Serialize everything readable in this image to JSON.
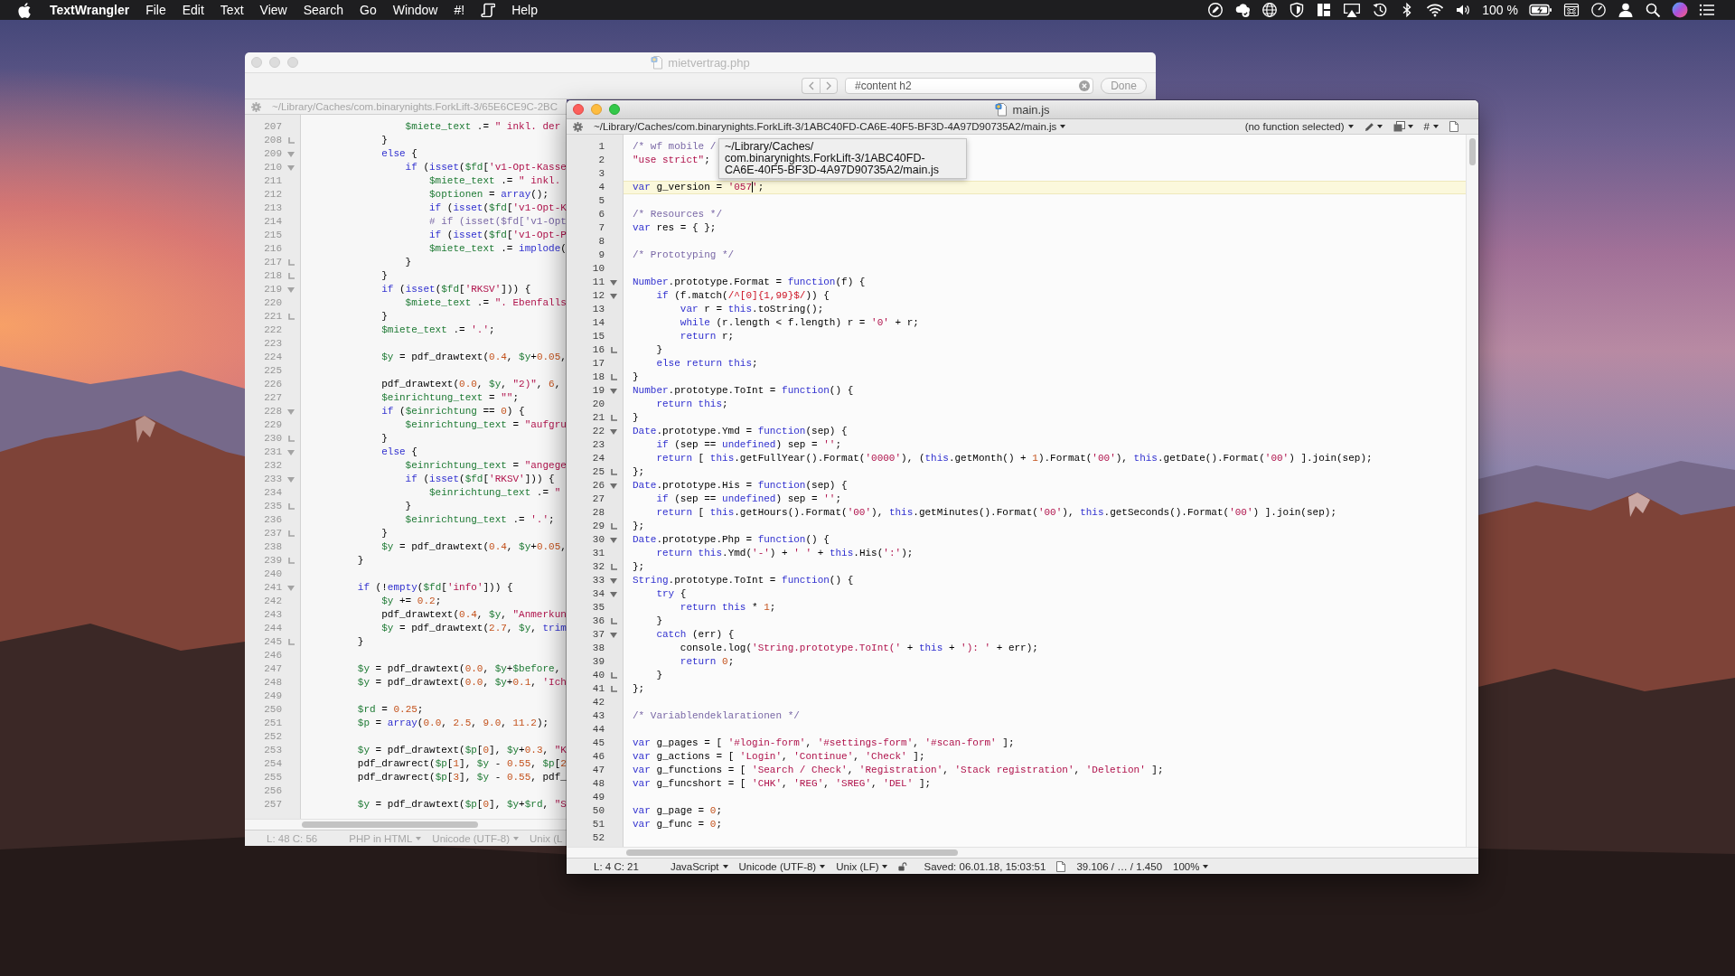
{
  "menu_bar": {
    "app_name": "TextWrangler",
    "menus": [
      {
        "kind": "label",
        "text": "File"
      },
      {
        "kind": "label",
        "text": "Edit"
      },
      {
        "kind": "label",
        "text": "Text"
      },
      {
        "kind": "label",
        "text": "View"
      },
      {
        "kind": "label",
        "text": "Search"
      },
      {
        "kind": "label",
        "text": "Go"
      },
      {
        "kind": "label",
        "text": "Window"
      },
      {
        "kind": "label",
        "text": "#!"
      },
      {
        "kind": "icon"
      },
      {
        "kind": "label",
        "text": "Help"
      }
    ],
    "battery_percent": "100 %"
  },
  "back_window": {
    "active": false,
    "title": "mietvertrag.php",
    "find_bar": {
      "query": "#content h2",
      "button": "Done"
    },
    "path_bar": {
      "path": {
        "kind": "label",
        "text": "~/Library/Caches/com.binarynights.ForkLift-3/65E6CE9C-2BC"
      }
    },
    "lines": [
      {
        "number": "207",
        "kind": "plain",
        "code": [
          {
            "variable": "                $miete_text"
          },
          {
            "plain": " .= "
          },
          {
            "string": "\" inkl. der"
          }
        ]
      },
      {
        "number": "208",
        "kind": "fold-end",
        "code": [
          {
            "plain": "            }"
          }
        ]
      },
      {
        "number": "209",
        "kind": "fold-start",
        "code": [
          {
            "keyword": "            else"
          },
          {
            "plain": " {"
          }
        ]
      },
      {
        "number": "210",
        "kind": "fold-start",
        "code": [
          {
            "keyword": "                if"
          },
          {
            "plain": " ("
          },
          {
            "keyword": "isset"
          },
          {
            "plain": "("
          },
          {
            "variable": "$fd"
          },
          {
            "plain": "["
          },
          {
            "string": "'v1-Opt-Kasse"
          }
        ]
      },
      {
        "number": "211",
        "kind": "plain",
        "code": [
          {
            "variable": "                    $miete_text"
          },
          {
            "plain": " .= "
          },
          {
            "string": "\" inkl."
          }
        ]
      },
      {
        "number": "212",
        "kind": "plain",
        "code": [
          {
            "variable": "                    $optionen"
          },
          {
            "plain": " = "
          },
          {
            "keyword": "array"
          },
          {
            "plain": "();"
          }
        ]
      },
      {
        "number": "213",
        "kind": "plain",
        "code": [
          {
            "keyword": "                    if"
          },
          {
            "plain": " ("
          },
          {
            "keyword": "isset"
          },
          {
            "plain": "("
          },
          {
            "variable": "$fd"
          },
          {
            "plain": "["
          },
          {
            "string": "'v1-Opt-K"
          }
        ]
      },
      {
        "number": "214",
        "kind": "plain",
        "code": [
          {
            "comment": "                    # if (isset($fd['v1-Opt"
          }
        ]
      },
      {
        "number": "215",
        "kind": "plain",
        "code": [
          {
            "keyword": "                    if"
          },
          {
            "plain": " ("
          },
          {
            "keyword": "isset"
          },
          {
            "plain": "("
          },
          {
            "variable": "$fd"
          },
          {
            "plain": "["
          },
          {
            "string": "'v1-Opt-P"
          }
        ]
      },
      {
        "number": "216",
        "kind": "plain",
        "code": [
          {
            "variable": "                    $miete_text"
          },
          {
            "plain": " .= "
          },
          {
            "keyword": "implode"
          },
          {
            "plain": "("
          }
        ]
      },
      {
        "number": "217",
        "kind": "fold-end",
        "code": [
          {
            "plain": "                }"
          }
        ]
      },
      {
        "number": "218",
        "kind": "fold-end",
        "code": [
          {
            "plain": "            }"
          }
        ]
      },
      {
        "number": "219",
        "kind": "fold-start",
        "code": [
          {
            "keyword": "            if"
          },
          {
            "plain": " ("
          },
          {
            "keyword": "isset"
          },
          {
            "plain": "("
          },
          {
            "variable": "$fd"
          },
          {
            "plain": "["
          },
          {
            "string": "'RKSV'"
          },
          {
            "plain": "])) {"
          }
        ]
      },
      {
        "number": "220",
        "kind": "plain",
        "code": [
          {
            "variable": "                $miete_text"
          },
          {
            "plain": " .= "
          },
          {
            "string": "\". Ebenfalls"
          }
        ]
      },
      {
        "number": "221",
        "kind": "fold-end",
        "code": [
          {
            "plain": "            }"
          }
        ]
      },
      {
        "number": "222",
        "kind": "plain",
        "code": [
          {
            "variable": "            $miete_text"
          },
          {
            "plain": " .= "
          },
          {
            "string": "'.'"
          },
          {
            "plain": ";"
          }
        ]
      },
      {
        "number": "223",
        "kind": "plain"
      },
      {
        "number": "224",
        "kind": "plain",
        "code": [
          {
            "variable": "            $y"
          },
          {
            "plain": " = pdf_drawtext("
          },
          {
            "number": "0.4"
          },
          {
            "plain": ", "
          },
          {
            "variable": "$y"
          },
          {
            "plain": "+"
          },
          {
            "number": "0.05"
          },
          {
            "plain": ","
          }
        ]
      },
      {
        "number": "225",
        "kind": "plain"
      },
      {
        "number": "226",
        "kind": "plain",
        "code": [
          {
            "plain": "            pdf_drawtext("
          },
          {
            "number": "0.0"
          },
          {
            "plain": ", "
          },
          {
            "variable": "$y"
          },
          {
            "plain": ", "
          },
          {
            "string": "\"2)\""
          },
          {
            "plain": ", "
          },
          {
            "number": "6"
          },
          {
            "plain": ","
          }
        ]
      },
      {
        "number": "227",
        "kind": "plain",
        "code": [
          {
            "variable": "            $einrichtung_text"
          },
          {
            "plain": " = "
          },
          {
            "string": "\"\""
          },
          {
            "plain": ";"
          }
        ]
      },
      {
        "number": "228",
        "kind": "fold-start",
        "code": [
          {
            "keyword": "            if"
          },
          {
            "plain": " ("
          },
          {
            "variable": "$einrichtung"
          },
          {
            "plain": " == "
          },
          {
            "number": "0"
          },
          {
            "plain": ") {"
          }
        ]
      },
      {
        "number": "229",
        "kind": "plain",
        "code": [
          {
            "variable": "                $einrichtung_text"
          },
          {
            "plain": " = "
          },
          {
            "string": "\"aufgru"
          }
        ]
      },
      {
        "number": "230",
        "kind": "fold-end",
        "code": [
          {
            "plain": "            }"
          }
        ]
      },
      {
        "number": "231",
        "kind": "fold-start",
        "code": [
          {
            "keyword": "            else"
          },
          {
            "plain": " {"
          }
        ]
      },
      {
        "number": "232",
        "kind": "plain",
        "code": [
          {
            "variable": "                $einrichtung_text"
          },
          {
            "plain": " = "
          },
          {
            "string": "\"angege"
          }
        ]
      },
      {
        "number": "233",
        "kind": "fold-start",
        "code": [
          {
            "keyword": "                if"
          },
          {
            "plain": " ("
          },
          {
            "keyword": "isset"
          },
          {
            "plain": "("
          },
          {
            "variable": "$fd"
          },
          {
            "plain": "["
          },
          {
            "string": "'RKSV'"
          },
          {
            "plain": "])) {"
          }
        ]
      },
      {
        "number": "234",
        "kind": "plain",
        "code": [
          {
            "variable": "                    $einrichtung_text"
          },
          {
            "plain": " .= "
          },
          {
            "string": "\""
          }
        ]
      },
      {
        "number": "235",
        "kind": "fold-end",
        "code": [
          {
            "plain": "                }"
          }
        ]
      },
      {
        "number": "236",
        "kind": "plain",
        "code": [
          {
            "variable": "                $einrichtung_text"
          },
          {
            "plain": " .= "
          },
          {
            "string": "'.'"
          },
          {
            "plain": ";"
          }
        ]
      },
      {
        "number": "237",
        "kind": "fold-end",
        "code": [
          {
            "plain": "            }"
          }
        ]
      },
      {
        "number": "238",
        "kind": "plain",
        "code": [
          {
            "variable": "            $y"
          },
          {
            "plain": " = pdf_drawtext("
          },
          {
            "number": "0.4"
          },
          {
            "plain": ", "
          },
          {
            "variable": "$y"
          },
          {
            "plain": "+"
          },
          {
            "number": "0.05"
          },
          {
            "plain": ","
          }
        ]
      },
      {
        "number": "239",
        "kind": "fold-end",
        "code": [
          {
            "plain": "        }"
          }
        ]
      },
      {
        "number": "240",
        "kind": "plain"
      },
      {
        "number": "241",
        "kind": "fold-start",
        "code": [
          {
            "keyword": "        if"
          },
          {
            "plain": " (!"
          },
          {
            "keyword": "empty"
          },
          {
            "plain": "("
          },
          {
            "variable": "$fd"
          },
          {
            "plain": "["
          },
          {
            "string": "'info'"
          },
          {
            "plain": "])) {"
          }
        ]
      },
      {
        "number": "242",
        "kind": "plain",
        "code": [
          {
            "variable": "            $y"
          },
          {
            "plain": " += "
          },
          {
            "number": "0.2"
          },
          {
            "plain": ";"
          }
        ]
      },
      {
        "number": "243",
        "kind": "plain",
        "code": [
          {
            "plain": "            pdf_drawtext("
          },
          {
            "number": "0.4"
          },
          {
            "plain": ", "
          },
          {
            "variable": "$y"
          },
          {
            "plain": ", "
          },
          {
            "string": "\"Anmerkun"
          }
        ]
      },
      {
        "number": "244",
        "kind": "plain",
        "code": [
          {
            "variable": "            $y"
          },
          {
            "plain": " = pdf_drawtext("
          },
          {
            "number": "2.7"
          },
          {
            "plain": ", "
          },
          {
            "variable": "$y"
          },
          {
            "plain": ", "
          },
          {
            "keyword": "trim"
          }
        ]
      },
      {
        "number": "245",
        "kind": "fold-end",
        "code": [
          {
            "plain": "        }"
          }
        ]
      },
      {
        "number": "246",
        "kind": "plain"
      },
      {
        "number": "247",
        "kind": "plain",
        "code": [
          {
            "variable": "        $y"
          },
          {
            "plain": " = pdf_drawtext("
          },
          {
            "number": "0.0"
          },
          {
            "plain": ", "
          },
          {
            "variable": "$y"
          },
          {
            "plain": "+"
          },
          {
            "variable": "$before"
          },
          {
            "plain": ","
          }
        ]
      },
      {
        "number": "248",
        "kind": "plain",
        "code": [
          {
            "variable": "        $y"
          },
          {
            "plain": " = pdf_drawtext("
          },
          {
            "number": "0.0"
          },
          {
            "plain": ", "
          },
          {
            "variable": "$y"
          },
          {
            "plain": "+"
          },
          {
            "number": "0.1"
          },
          {
            "plain": ", "
          },
          {
            "string": "'Ich"
          }
        ]
      },
      {
        "number": "249",
        "kind": "plain"
      },
      {
        "number": "250",
        "kind": "plain",
        "code": [
          {
            "variable": "        $rd"
          },
          {
            "plain": " = "
          },
          {
            "number": "0.25"
          },
          {
            "plain": ";"
          }
        ]
      },
      {
        "number": "251",
        "kind": "plain",
        "code": [
          {
            "variable": "        $p"
          },
          {
            "plain": " = "
          },
          {
            "keyword": "array"
          },
          {
            "plain": "("
          },
          {
            "number": "0.0"
          },
          {
            "plain": ", "
          },
          {
            "number": "2.5"
          },
          {
            "plain": ", "
          },
          {
            "number": "9.0"
          },
          {
            "plain": ", "
          },
          {
            "number": "11.2"
          },
          {
            "plain": ");"
          }
        ]
      },
      {
        "number": "252",
        "kind": "plain"
      },
      {
        "number": "253",
        "kind": "plain",
        "code": [
          {
            "variable": "        $y"
          },
          {
            "plain": " = pdf_drawtext("
          },
          {
            "variable": "$p"
          },
          {
            "plain": "["
          },
          {
            "number": "0"
          },
          {
            "plain": "], "
          },
          {
            "variable": "$y"
          },
          {
            "plain": "+"
          },
          {
            "number": "0.3"
          },
          {
            "plain": ", "
          },
          {
            "string": "\"K"
          }
        ]
      },
      {
        "number": "254",
        "kind": "plain",
        "code": [
          {
            "plain": "        pdf_drawrect("
          },
          {
            "variable": "$p"
          },
          {
            "plain": "["
          },
          {
            "number": "1"
          },
          {
            "plain": "], "
          },
          {
            "variable": "$y"
          },
          {
            "plain": " - "
          },
          {
            "number": "0.55"
          },
          {
            "plain": ", "
          },
          {
            "variable": "$p"
          },
          {
            "plain": "["
          },
          {
            "number": "2"
          }
        ]
      },
      {
        "number": "255",
        "kind": "plain",
        "code": [
          {
            "plain": "        pdf_drawrect("
          },
          {
            "variable": "$p"
          },
          {
            "plain": "["
          },
          {
            "number": "3"
          },
          {
            "plain": "], "
          },
          {
            "variable": "$y"
          },
          {
            "plain": " - "
          },
          {
            "number": "0.55"
          },
          {
            "plain": ", pdf_"
          }
        ]
      },
      {
        "number": "256",
        "kind": "plain"
      },
      {
        "number": "257",
        "kind": "plain",
        "code": [
          {
            "variable": "        $y"
          },
          {
            "plain": " = pdf_drawtext("
          },
          {
            "variable": "$p"
          },
          {
            "plain": "["
          },
          {
            "number": "0"
          },
          {
            "plain": "], "
          },
          {
            "variable": "$y"
          },
          {
            "plain": "+"
          },
          {
            "variable": "$rd"
          },
          {
            "plain": ", "
          },
          {
            "string": "\"S"
          }
        ]
      }
    ],
    "status_bar": [
      {
        "kind": "label",
        "text": "L: 48 C: 56"
      },
      {
        "kind": "menu",
        "text": "PHP in HTML"
      },
      {
        "kind": "menu",
        "text": "Unicode (UTF-8)"
      },
      {
        "kind": "label",
        "text": "Unix (L"
      }
    ]
  },
  "front_window": {
    "active": true,
    "title": "main.js",
    "path_bar": {
      "path": {
        "kind": "menu",
        "text": "~/Library/Caches/com.binarynights.ForkLift-3/1ABC40FD-CA6E-40F5-BF3D-4A97D90735A2/main.js"
      },
      "tools": [
        {
          "kind": "menu",
          "text": "(no function selected)"
        },
        {
          "kind": "pen-menu"
        },
        {
          "kind": "pages-menu"
        },
        {
          "kind": "menu",
          "text": "#"
        },
        {
          "kind": "document"
        }
      ]
    },
    "tooltip": {
      "lines": [
        "~/Library/Caches/",
        "com.binarynights.ForkLift-3/1ABC40FD-",
        "CA6E-40F5-BF3D-4A97D90735A2/main.js"
      ]
    },
    "lines": [
      {
        "number": "1",
        "kind": "plain",
        "code": [
          {
            "comment": "/* wf mobile /"
          }
        ]
      },
      {
        "number": "2",
        "kind": "plain",
        "code": [
          {
            "string": "\"use strict\""
          },
          {
            "plain": ";"
          }
        ]
      },
      {
        "number": "3",
        "kind": "plain"
      },
      {
        "number": "4",
        "kind": "plain",
        "current": true,
        "code": [
          {
            "keyword": "var"
          },
          {
            "plain": " g_version = "
          },
          {
            "string": "'057"
          },
          {
            "caret": true
          },
          {
            "string": "'"
          },
          {
            "plain": ";"
          }
        ]
      },
      {
        "number": "5",
        "kind": "plain"
      },
      {
        "number": "6",
        "kind": "plain",
        "code": [
          {
            "comment": "/* Resources */"
          }
        ]
      },
      {
        "number": "7",
        "kind": "plain",
        "code": [
          {
            "keyword": "var"
          },
          {
            "plain": " res = { };"
          }
        ]
      },
      {
        "number": "8",
        "kind": "plain"
      },
      {
        "number": "9",
        "kind": "plain",
        "code": [
          {
            "comment": "/* Prototyping */"
          }
        ]
      },
      {
        "number": "10",
        "kind": "plain"
      },
      {
        "number": "11",
        "kind": "fold-start",
        "code": [
          {
            "keyword": "Number"
          },
          {
            "plain": ".prototype.Format = "
          },
          {
            "keyword": "function"
          },
          {
            "plain": "(f) {"
          }
        ]
      },
      {
        "number": "12",
        "kind": "fold-start",
        "code": [
          {
            "keyword": "    if"
          },
          {
            "plain": " (f.match("
          },
          {
            "regex": "/^[0]{1,99}$/"
          },
          {
            "plain": ")) {"
          }
        ]
      },
      {
        "number": "13",
        "kind": "plain",
        "code": [
          {
            "keyword": "        var"
          },
          {
            "plain": " r = "
          },
          {
            "keyword": "this"
          },
          {
            "plain": ".toString();"
          }
        ]
      },
      {
        "number": "14",
        "kind": "plain",
        "code": [
          {
            "keyword": "        while"
          },
          {
            "plain": " (r.length < f.length) r = "
          },
          {
            "string": "'0'"
          },
          {
            "plain": " + r;"
          }
        ]
      },
      {
        "number": "15",
        "kind": "plain",
        "code": [
          {
            "keyword": "        return"
          },
          {
            "plain": " r;"
          }
        ]
      },
      {
        "number": "16",
        "kind": "fold-end",
        "code": [
          {
            "plain": "    }"
          }
        ]
      },
      {
        "number": "17",
        "kind": "plain",
        "code": [
          {
            "keyword": "    else return this"
          },
          {
            "plain": ";"
          }
        ]
      },
      {
        "number": "18",
        "kind": "fold-end",
        "code": [
          {
            "plain": "}"
          }
        ]
      },
      {
        "number": "19",
        "kind": "fold-start",
        "code": [
          {
            "keyword": "Number"
          },
          {
            "plain": ".prototype.ToInt = "
          },
          {
            "keyword": "function"
          },
          {
            "plain": "() {"
          }
        ]
      },
      {
        "number": "20",
        "kind": "plain",
        "code": [
          {
            "keyword": "    return this"
          },
          {
            "plain": ";"
          }
        ]
      },
      {
        "number": "21",
        "kind": "fold-end",
        "code": [
          {
            "plain": "}"
          }
        ]
      },
      {
        "number": "22",
        "kind": "fold-start",
        "code": [
          {
            "keyword": "Date"
          },
          {
            "plain": ".prototype.Ymd = "
          },
          {
            "keyword": "function"
          },
          {
            "plain": "(sep) {"
          }
        ]
      },
      {
        "number": "23",
        "kind": "plain",
        "code": [
          {
            "keyword": "    if"
          },
          {
            "plain": " (sep == "
          },
          {
            "keyword": "undefined"
          },
          {
            "plain": ") sep = "
          },
          {
            "string": "''"
          },
          {
            "plain": ";"
          }
        ]
      },
      {
        "number": "24",
        "kind": "plain",
        "code": [
          {
            "keyword": "    return"
          },
          {
            "plain": " [ "
          },
          {
            "keyword": "this"
          },
          {
            "plain": ".getFullYear().Format("
          },
          {
            "string": "'0000'"
          },
          {
            "plain": "), ("
          },
          {
            "keyword": "this"
          },
          {
            "plain": ".getMonth() + "
          },
          {
            "number": "1"
          },
          {
            "plain": ").Format("
          },
          {
            "string": "'00'"
          },
          {
            "plain": "), "
          },
          {
            "keyword": "this"
          },
          {
            "plain": ".getDate().Format("
          },
          {
            "string": "'00'"
          },
          {
            "plain": ") ].join(sep);"
          }
        ]
      },
      {
        "number": "25",
        "kind": "fold-end",
        "code": [
          {
            "plain": "};"
          }
        ]
      },
      {
        "number": "26",
        "kind": "fold-start",
        "code": [
          {
            "keyword": "Date"
          },
          {
            "plain": ".prototype.His = "
          },
          {
            "keyword": "function"
          },
          {
            "plain": "(sep) {"
          }
        ]
      },
      {
        "number": "27",
        "kind": "plain",
        "code": [
          {
            "keyword": "    if"
          },
          {
            "plain": " (sep == "
          },
          {
            "keyword": "undefined"
          },
          {
            "plain": ") sep = "
          },
          {
            "string": "''"
          },
          {
            "plain": ";"
          }
        ]
      },
      {
        "number": "28",
        "kind": "plain",
        "code": [
          {
            "keyword": "    return"
          },
          {
            "plain": " [ "
          },
          {
            "keyword": "this"
          },
          {
            "plain": ".getHours().Format("
          },
          {
            "string": "'00'"
          },
          {
            "plain": "), "
          },
          {
            "keyword": "this"
          },
          {
            "plain": ".getMinutes().Format("
          },
          {
            "string": "'00'"
          },
          {
            "plain": "), "
          },
          {
            "keyword": "this"
          },
          {
            "plain": ".getSeconds().Format("
          },
          {
            "string": "'00'"
          },
          {
            "plain": ") ].join(sep);"
          }
        ]
      },
      {
        "number": "29",
        "kind": "fold-end",
        "code": [
          {
            "plain": "};"
          }
        ]
      },
      {
        "number": "30",
        "kind": "fold-start",
        "code": [
          {
            "keyword": "Date"
          },
          {
            "plain": ".prototype.Php = "
          },
          {
            "keyword": "function"
          },
          {
            "plain": "() {"
          }
        ]
      },
      {
        "number": "31",
        "kind": "plain",
        "code": [
          {
            "keyword": "    return this"
          },
          {
            "plain": ".Ymd("
          },
          {
            "string": "'-'"
          },
          {
            "plain": ") + "
          },
          {
            "string": "' '"
          },
          {
            "plain": " + "
          },
          {
            "keyword": "this"
          },
          {
            "plain": ".His("
          },
          {
            "string": "':'"
          },
          {
            "plain": ");"
          }
        ]
      },
      {
        "number": "32",
        "kind": "fold-end",
        "code": [
          {
            "plain": "};"
          }
        ]
      },
      {
        "number": "33",
        "kind": "fold-start",
        "code": [
          {
            "keyword": "String"
          },
          {
            "plain": ".prototype.ToInt = "
          },
          {
            "keyword": "function"
          },
          {
            "plain": "() {"
          }
        ]
      },
      {
        "number": "34",
        "kind": "fold-start",
        "code": [
          {
            "keyword": "    try"
          },
          {
            "plain": " {"
          }
        ]
      },
      {
        "number": "35",
        "kind": "plain",
        "code": [
          {
            "keyword": "        return this"
          },
          {
            "plain": " * "
          },
          {
            "number": "1"
          },
          {
            "plain": ";"
          }
        ]
      },
      {
        "number": "36",
        "kind": "fold-end",
        "code": [
          {
            "plain": "    }"
          }
        ]
      },
      {
        "number": "37",
        "kind": "fold-start",
        "code": [
          {
            "keyword": "    catch"
          },
          {
            "plain": " (err) {"
          }
        ]
      },
      {
        "number": "38",
        "kind": "plain",
        "code": [
          {
            "plain": "        console.log("
          },
          {
            "string": "'String.prototype.ToInt('"
          },
          {
            "plain": " + "
          },
          {
            "keyword": "this"
          },
          {
            "plain": " + "
          },
          {
            "string": "'): '"
          },
          {
            "plain": " + err);"
          }
        ]
      },
      {
        "number": "39",
        "kind": "plain",
        "code": [
          {
            "keyword": "        return"
          },
          {
            "number": " 0"
          },
          {
            "plain": ";"
          }
        ]
      },
      {
        "number": "40",
        "kind": "fold-end",
        "code": [
          {
            "plain": "    }"
          }
        ]
      },
      {
        "number": "41",
        "kind": "fold-end",
        "code": [
          {
            "plain": "};"
          }
        ]
      },
      {
        "number": "42",
        "kind": "plain"
      },
      {
        "number": "43",
        "kind": "plain",
        "code": [
          {
            "comment": "/* Variablendeklarationen */"
          }
        ]
      },
      {
        "number": "44",
        "kind": "plain"
      },
      {
        "number": "45",
        "kind": "plain",
        "code": [
          {
            "keyword": "var"
          },
          {
            "plain": " g_pages = [ "
          },
          {
            "string": "'#login-form'"
          },
          {
            "plain": ", "
          },
          {
            "string": "'#settings-form'"
          },
          {
            "plain": ", "
          },
          {
            "string": "'#scan-form'"
          },
          {
            "plain": " ];"
          }
        ]
      },
      {
        "number": "46",
        "kind": "plain",
        "code": [
          {
            "keyword": "var"
          },
          {
            "plain": " g_actions = [ "
          },
          {
            "string": "'Login'"
          },
          {
            "plain": ", "
          },
          {
            "string": "'Continue'"
          },
          {
            "plain": ", "
          },
          {
            "string": "'Check'"
          },
          {
            "plain": " ];"
          }
        ]
      },
      {
        "number": "47",
        "kind": "plain",
        "code": [
          {
            "keyword": "var"
          },
          {
            "plain": " g_functions = [ "
          },
          {
            "string": "'Search / Check'"
          },
          {
            "plain": ", "
          },
          {
            "string": "'Registration'"
          },
          {
            "plain": ", "
          },
          {
            "string": "'Stack registration'"
          },
          {
            "plain": ", "
          },
          {
            "string": "'Deletion'"
          },
          {
            "plain": " ];"
          }
        ]
      },
      {
        "number": "48",
        "kind": "plain",
        "code": [
          {
            "keyword": "var"
          },
          {
            "plain": " g_funcshort = [ "
          },
          {
            "string": "'CHK'"
          },
          {
            "plain": ", "
          },
          {
            "string": "'REG'"
          },
          {
            "plain": ", "
          },
          {
            "string": "'SREG'"
          },
          {
            "plain": ", "
          },
          {
            "string": "'DEL'"
          },
          {
            "plain": " ];"
          }
        ]
      },
      {
        "number": "49",
        "kind": "plain"
      },
      {
        "number": "50",
        "kind": "plain",
        "code": [
          {
            "keyword": "var"
          },
          {
            "plain": " g_page = "
          },
          {
            "number": "0"
          },
          {
            "plain": ";"
          }
        ]
      },
      {
        "number": "51",
        "kind": "plain",
        "code": [
          {
            "keyword": "var"
          },
          {
            "plain": " g_func = "
          },
          {
            "number": "0"
          },
          {
            "plain": ";"
          }
        ]
      },
      {
        "number": "52",
        "kind": "plain"
      }
    ],
    "status_bar": [
      {
        "kind": "label",
        "text": "L: 4 C: 21"
      },
      {
        "kind": "menu",
        "text": "JavaScript"
      },
      {
        "kind": "menu",
        "text": "Unicode (UTF-8)"
      },
      {
        "kind": "menu",
        "text": "Unix (LF)"
      },
      {
        "kind": "saved",
        "text": "Saved: 06.01.18, 15:03:51"
      },
      {
        "kind": "stats",
        "text": "39.106 / … / 1.450"
      },
      {
        "kind": "menu",
        "text": "100%"
      }
    ]
  }
}
